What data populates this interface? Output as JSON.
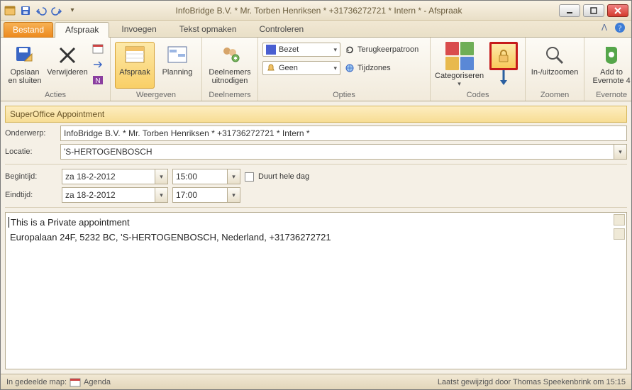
{
  "title": "InfoBridge B.V. * Mr. Torben Henriksen * +31736272721 * Intern *  -  Afspraak",
  "tabs": {
    "file": "Bestand",
    "items": [
      "Afspraak",
      "Invoegen",
      "Tekst opmaken",
      "Controleren"
    ],
    "active": 0
  },
  "ribbon": {
    "groups": {
      "acties": {
        "label": "Acties",
        "saveclose": "Opslaan\nen sluiten",
        "delete": "Verwijderen"
      },
      "weergeven": {
        "label": "Weergeven",
        "afspraak": "Afspraak",
        "planning": "Planning"
      },
      "deelnemers": {
        "label": "Deelnemers",
        "invite": "Deelnemers\nuitnodigen"
      },
      "opties": {
        "label": "Opties",
        "showas_label": "Bezet",
        "reminder_label": "Geen",
        "recurrence": "Terugkeerpatroon",
        "timezones": "Tijdzones"
      },
      "codes": {
        "label": "Codes",
        "categorize": "Categoriseren"
      },
      "zoomen": {
        "label": "Zoomen",
        "zoom": "In-/uitzoomen"
      },
      "evernote": {
        "label": "Evernote",
        "add": "Add to\nEvernote 4"
      }
    }
  },
  "banner": "SuperOffice Appointment",
  "fields": {
    "subject_label": "Onderwerp:",
    "subject_value": "InfoBridge B.V. * Mr. Torben Henriksen * +31736272721 * Intern *",
    "location_label": "Locatie:",
    "location_value": "'S-HERTOGENBOSCH",
    "start_label": "Begintijd:",
    "start_date": "za 18-2-2012",
    "start_time": "15:00",
    "end_label": "Eindtijd:",
    "end_date": "za 18-2-2012",
    "end_time": "17:00",
    "allday_label": "Duurt hele dag"
  },
  "body": {
    "line1": "This is a Private appointment",
    "line2": "Europalaan 24F, 5232 BC, 'S-HERTOGENBOSCH, Nederland, +31736272721"
  },
  "status": {
    "left_prefix": "In gedeelde map:",
    "left_value": "Agenda",
    "right": "Laatst gewijzigd door Thomas Speekenbrink om 15:15"
  },
  "colors": {
    "accent_orange": "#ed8a1f",
    "highlight_red": "#c61a1a",
    "ribbon_bg": "#f1eadb"
  }
}
